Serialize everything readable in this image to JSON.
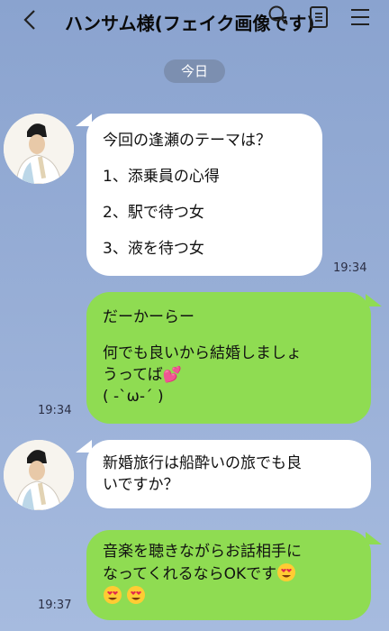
{
  "header": {
    "title": "ハンサム様(フェイク画像です)",
    "icons": [
      "back-icon",
      "search-icon",
      "note-icon",
      "menu-icon"
    ]
  },
  "date_label": "今日",
  "messages": [
    {
      "side": "received",
      "lines": [
        "今回の逢瀬のテーマは？",
        "1、添乗員の心得",
        "2、駅で待つ女",
        "3、液を待つ女"
      ],
      "time": "19:34"
    },
    {
      "side": "sent",
      "lines": [
        "だーかーらー",
        "何でも良いから結婚しましょ",
        "うってば",
        "( -`ω-´ )"
      ],
      "time": "19:34"
    },
    {
      "side": "received",
      "lines": [
        "新婚旅行は船酔いの旅でも良",
        "いですか？"
      ],
      "time": ""
    },
    {
      "side": "sent",
      "lines": [
        "音楽を聴きながらお話相手に",
        "なってくれるならOKです"
      ],
      "time": "19:37"
    }
  ],
  "colors": {
    "background": "#9bb1d8",
    "received_bubble": "#ffffff",
    "sent_bubble": "#8fdc52",
    "date_pill": "#7c8fb0"
  }
}
